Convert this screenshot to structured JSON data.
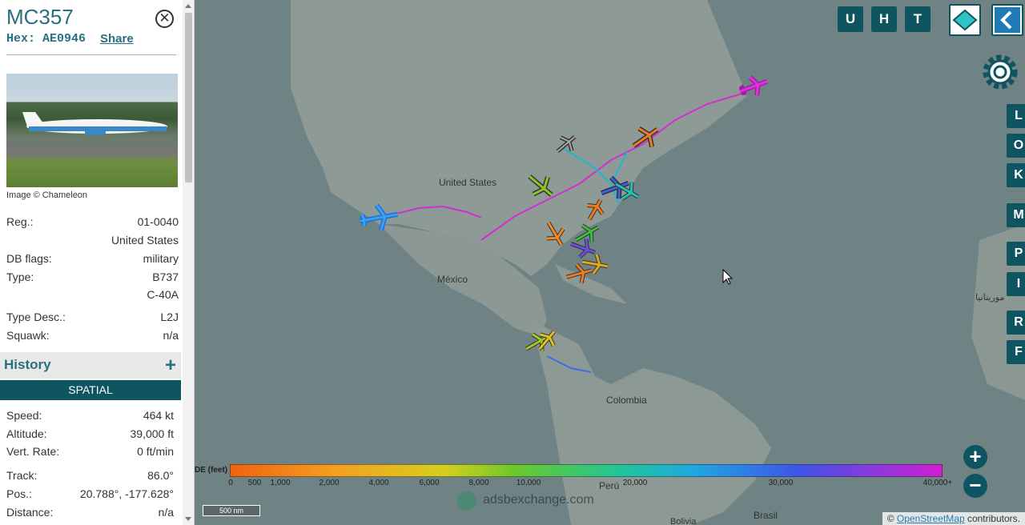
{
  "aircraft": {
    "callsign": "MC357",
    "hex_label": "Hex:",
    "hex": "AE0946",
    "share_label": "Share",
    "close_symbol": "✕",
    "photo_credit": "Image © Chameleon"
  },
  "details": [
    {
      "key": "Reg.:",
      "value": "01-0040"
    },
    {
      "key": "",
      "value": "United States"
    },
    {
      "key": "DB flags:",
      "value": "military"
    },
    {
      "key": "Type:",
      "value": "B737"
    },
    {
      "key": "",
      "value": "C-40A"
    },
    {
      "key": "Type Desc.:",
      "value": "L2J"
    },
    {
      "key": "Squawk:",
      "value": "n/a"
    }
  ],
  "history": {
    "title": "History",
    "plus": "+"
  },
  "spatial": {
    "title": "SPATIAL",
    "rows": [
      {
        "key": "Speed:",
        "value": "464 kt"
      },
      {
        "key": "Altitude:",
        "value": "39,000 ft"
      },
      {
        "key": "Vert. Rate:",
        "value": "0 ft/min"
      },
      {
        "key": "Track:",
        "value": "86.0°"
      },
      {
        "key": "Pos.:",
        "value": "20.788°, -177.628°"
      },
      {
        "key": "Distance:",
        "value": "n/a"
      }
    ]
  },
  "map": {
    "labels": {
      "us": "United States",
      "mexico": "México",
      "colombia": "Colombia",
      "peru": "Perú",
      "brasil": "Brasil",
      "bolivia": "Bolivia",
      "arabic": "موريتانيا"
    },
    "top_buttons": [
      "U",
      "H",
      "T"
    ],
    "right_buttons": [
      "L",
      "O",
      "K",
      "M",
      "P",
      "I",
      "R",
      "F"
    ],
    "zoom_in": "+",
    "zoom_out": "−",
    "scale": "500 nm",
    "watermark": "adsbexchange.com",
    "attribution_prefix": "© ",
    "attribution_link": "OpenStreetMap",
    "attribution_suffix": " contributors.",
    "legend": {
      "unit_label": "DE (feet)",
      "ticks": [
        "0",
        "500",
        "1,000",
        "2,000",
        "4,000",
        "6,000",
        "8,000",
        "10,000",
        "20,000",
        "30,000",
        "40,000+"
      ]
    }
  }
}
